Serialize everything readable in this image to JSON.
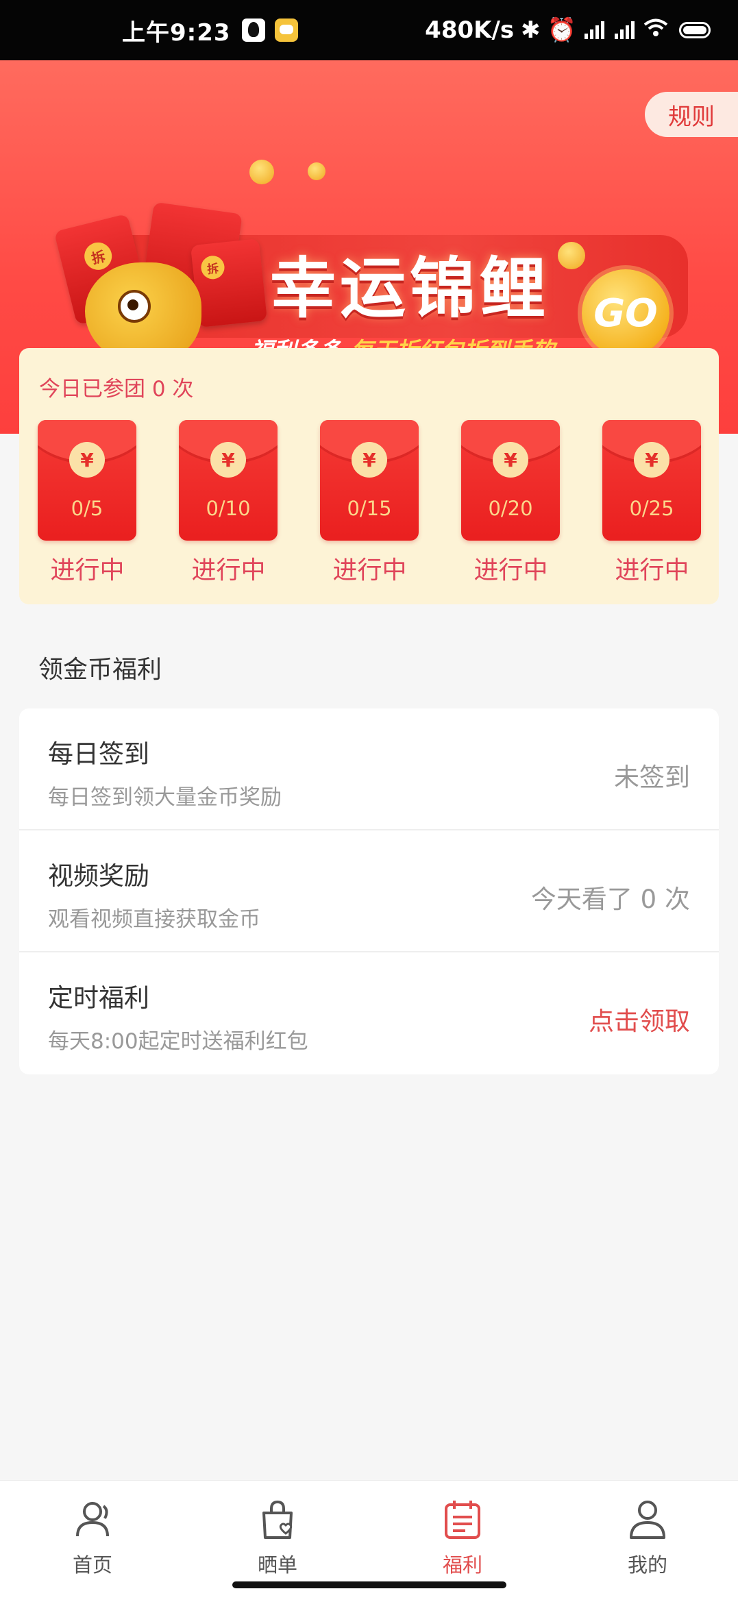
{
  "status_bar": {
    "time": "上午9:23",
    "network_speed": "480K/s"
  },
  "header": {
    "rules_label": "规则",
    "banner": {
      "title": "幸运锦鲤",
      "subtitle_left": "福利多多",
      "subtitle_right": "每天拆红包拆到手软",
      "go_label": "GO",
      "envelope_badge": "拆"
    }
  },
  "group": {
    "count_text": "今日已参团 0 次",
    "currency_symbol": "¥",
    "packets": [
      {
        "progress": "0/5",
        "status": "进行中"
      },
      {
        "progress": "0/10",
        "status": "进行中"
      },
      {
        "progress": "0/15",
        "status": "进行中"
      },
      {
        "progress": "0/20",
        "status": "进行中"
      },
      {
        "progress": "0/25",
        "status": "进行中"
      }
    ]
  },
  "welfare": {
    "section_title": "领金币福利",
    "items": [
      {
        "title": "每日签到",
        "desc": "每日签到领大量金币奖励",
        "action": "未签到"
      },
      {
        "title": "视频奖励",
        "desc": "观看视频直接获取金币",
        "action": "今天看了 0 次"
      },
      {
        "title": "定时福利",
        "desc": "每天8:00起定时送福利红包",
        "action": "点击领取"
      }
    ]
  },
  "nav": {
    "items": [
      {
        "label": "首页",
        "icon": "user-icon"
      },
      {
        "label": "晒单",
        "icon": "bag-heart-icon"
      },
      {
        "label": "福利",
        "icon": "calendar-list-icon"
      },
      {
        "label": "我的",
        "icon": "person-icon"
      }
    ],
    "active_index": 2
  },
  "colors": {
    "brand_red": "#ff4a45",
    "accent_pink": "#e14d4d",
    "panel_cream": "#fdf3d6"
  }
}
